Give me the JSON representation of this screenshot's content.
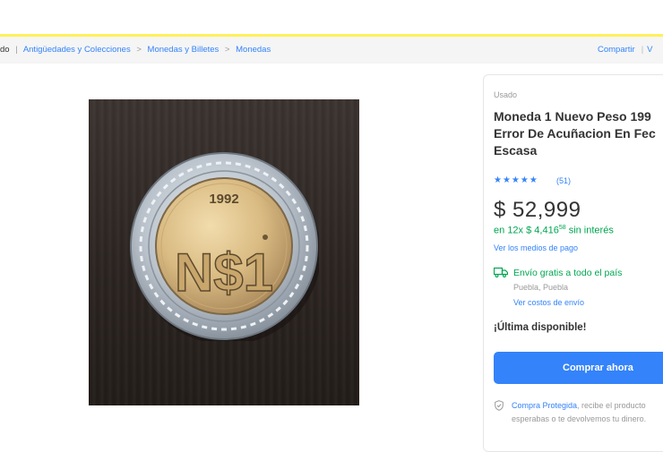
{
  "breadcrumb": {
    "cut_start": "do",
    "items": [
      "Antigüedades y Colecciones",
      "Monedas y Billetes",
      "Monedas"
    ],
    "separator": ">"
  },
  "share": {
    "label": "Compartir",
    "cut_end": "V"
  },
  "product": {
    "condition": "Usado",
    "title": "Moneda 1 Nuevo Peso 199\nError De Acuñacion En Fec\nEscasa",
    "rating_stars": "★★★★★",
    "rating": 4.5,
    "reviews": "(51)",
    "price": "$ 52,999",
    "installments_prefix": "en",
    "installments_count": "12x",
    "installment_amount": "$ 4,416",
    "installment_cents": "58",
    "installments_suffix": "sin interés",
    "payment_link": "Ver los medios de pago",
    "shipping": "Envío gratis a todo el país",
    "location": "Puebla, Puebla",
    "shipping_costs": "Ver costos de envío",
    "availability": "¡Última disponible!",
    "buy_button": "Comprar ahora",
    "protect_link": "Compra Protegida",
    "protect_text": ", recibe el producto",
    "protect_line2": "esperabas o te devolvemos tu dinero."
  },
  "coin": {
    "year": "1992",
    "denomination": "N$1"
  },
  "colors": {
    "accent": "#3483fa",
    "green": "#00a650",
    "header_yellow": "#fff159"
  }
}
